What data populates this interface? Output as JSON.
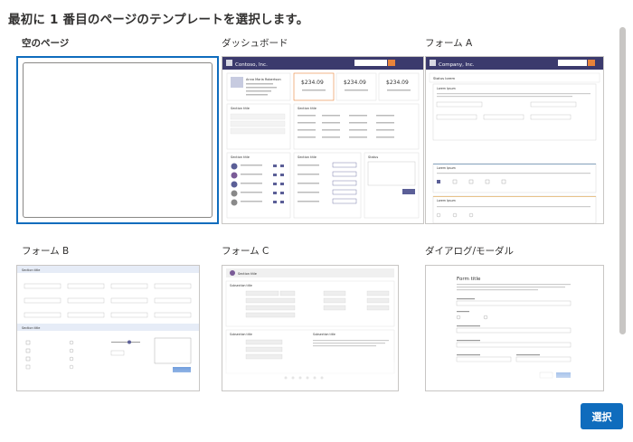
{
  "heading": "最初に 1 番目のページのテンプレートを選択します。",
  "templates": [
    {
      "label": "空のページ"
    },
    {
      "label": "ダッシュボード",
      "app_title": "Contoso, Inc.",
      "search": "Search",
      "profile_name": "Anna Maria Robertson",
      "amount": "$234.09",
      "section": "Section title",
      "status": "Status"
    },
    {
      "label": "フォーム A",
      "app_title": "Company, Inc.",
      "search": "Search",
      "status": "Status lorem",
      "section": "Lorem Ipsum"
    },
    {
      "label": "フォーム B",
      "section": "Section title"
    },
    {
      "label": "フォーム C",
      "section": "Section title",
      "subsection": "Subsection title"
    },
    {
      "label": "ダイアログ/モーダル",
      "form_title": "Form title"
    }
  ],
  "select_button": "選択",
  "colors": {
    "accent": "#0f6cbd",
    "header": "#3b3a6d",
    "orange": "#e8833a"
  }
}
